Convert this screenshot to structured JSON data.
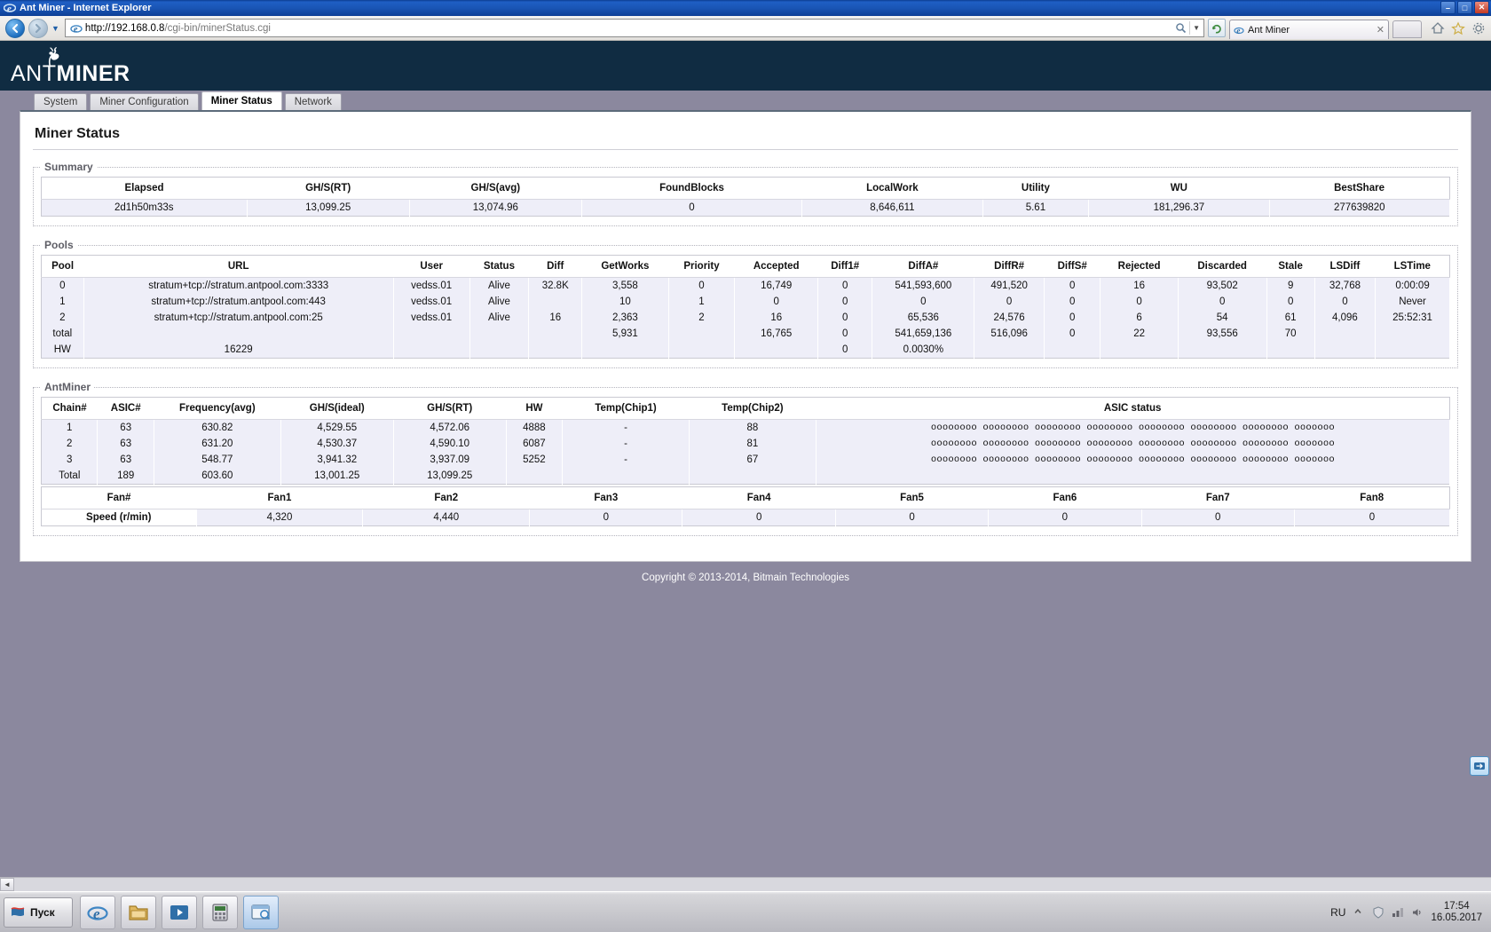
{
  "window": {
    "title": "Ant Miner - Internet Explorer",
    "minimize_label": "–",
    "maximize_label": "□",
    "close_label": "✕"
  },
  "browser": {
    "back_label": "◄",
    "forward_label": "►",
    "history_caret": "▼",
    "url_host": "http://192.168.0.8",
    "url_path": "/cgi-bin/minerStatus.cgi",
    "url_full": "http://192.168.0.8/cgi-bin/minerStatus.cgi",
    "tab_title": "Ant Miner",
    "tab_close": "✕",
    "refresh_label": "↯",
    "home_icon": "home-icon",
    "favorites_icon": "star-icon",
    "tools_icon": "gear-icon"
  },
  "site": {
    "logo_ant": "ANT",
    "logo_miner": "MINER",
    "nav_tabs": [
      {
        "label": "System",
        "active": false
      },
      {
        "label": "Miner Configuration",
        "active": false
      },
      {
        "label": "Miner Status",
        "active": true
      },
      {
        "label": "Network",
        "active": false
      }
    ],
    "page_title": "Miner Status",
    "copyright": "Copyright © 2013-2014, Bitmain Technologies"
  },
  "summary": {
    "legend": "Summary",
    "headers": [
      "Elapsed",
      "GH/S(RT)",
      "GH/S(avg)",
      "FoundBlocks",
      "LocalWork",
      "Utility",
      "WU",
      "BestShare"
    ],
    "values": [
      "2d1h50m33s",
      "13,099.25",
      "13,074.96",
      "0",
      "8,646,611",
      "5.61",
      "181,296.37",
      "277639820"
    ]
  },
  "pools": {
    "legend": "Pools",
    "headers": [
      "Pool",
      "URL",
      "User",
      "Status",
      "Diff",
      "GetWorks",
      "Priority",
      "Accepted",
      "Diff1#",
      "DiffA#",
      "DiffR#",
      "DiffS#",
      "Rejected",
      "Discarded",
      "Stale",
      "LSDiff",
      "LSTime"
    ],
    "rows": [
      [
        "0",
        "stratum+tcp://stratum.antpool.com:3333",
        "vedss.01",
        "Alive",
        "32.8K",
        "3,558",
        "0",
        "16,749",
        "0",
        "541,593,600",
        "491,520",
        "0",
        "16",
        "93,502",
        "9",
        "32,768",
        "0:00:09"
      ],
      [
        "1",
        "stratum+tcp://stratum.antpool.com:443",
        "vedss.01",
        "Alive",
        "",
        "10",
        "1",
        "0",
        "0",
        "0",
        "0",
        "0",
        "0",
        "0",
        "0",
        "0",
        "Never"
      ],
      [
        "2",
        "stratum+tcp://stratum.antpool.com:25",
        "vedss.01",
        "Alive",
        "16",
        "2,363",
        "2",
        "16",
        "0",
        "65,536",
        "24,576",
        "0",
        "6",
        "54",
        "61",
        "4,096",
        "25:52:31"
      ],
      [
        "total",
        "",
        "",
        "",
        "",
        "5,931",
        "",
        "16,765",
        "0",
        "541,659,136",
        "516,096",
        "0",
        "22",
        "93,556",
        "70",
        "",
        ""
      ],
      [
        "HW",
        "16229",
        "",
        "",
        "",
        "",
        "",
        "",
        "0",
        "0.0030%",
        "",
        "",
        "",
        "",
        "",
        "",
        ""
      ]
    ]
  },
  "antminer": {
    "legend": "AntMiner",
    "headers": [
      "Chain#",
      "ASIC#",
      "Frequency(avg)",
      "GH/S(ideal)",
      "GH/S(RT)",
      "HW",
      "Temp(Chip1)",
      "Temp(Chip2)",
      "ASIC status"
    ],
    "rows": [
      [
        "1",
        "63",
        "630.82",
        "4,529.55",
        "4,572.06",
        "4888",
        "-",
        "88",
        "oooooooo oooooooo oooooooo oooooooo oooooooo oooooooo oooooooo ooooooo"
      ],
      [
        "2",
        "63",
        "631.20",
        "4,530.37",
        "4,590.10",
        "6087",
        "-",
        "81",
        "oooooooo oooooooo oooooooo oooooooo oooooooo oooooooo oooooooo ooooooo"
      ],
      [
        "3",
        "63",
        "548.77",
        "3,941.32",
        "3,937.09",
        "5252",
        "-",
        "67",
        "oooooooo oooooooo oooooooo oooooooo oooooooo oooooooo oooooooo ooooooo"
      ],
      [
        "Total",
        "189",
        "603.60",
        "13,001.25",
        "13,099.25",
        "",
        "",
        "",
        ""
      ]
    ]
  },
  "fans": {
    "headers": [
      "Fan#",
      "Fan1",
      "Fan2",
      "Fan3",
      "Fan4",
      "Fan5",
      "Fan6",
      "Fan7",
      "Fan8"
    ],
    "row_label": "Speed (r/min)",
    "values": [
      "4,320",
      "4,440",
      "0",
      "0",
      "0",
      "0",
      "0",
      "0"
    ]
  },
  "taskbar": {
    "start_label": "Пуск",
    "items": [
      {
        "name": "internet-explorer",
        "glyph": "e",
        "active": true
      },
      {
        "name": "file-explorer",
        "glyph": "🗂",
        "active": false
      },
      {
        "name": "media-player",
        "glyph": "▶",
        "active": false
      },
      {
        "name": "calculator",
        "glyph": "▤",
        "active": false
      },
      {
        "name": "browser-window",
        "glyph": "◧",
        "active": false
      }
    ],
    "language": "RU",
    "time": "17:54",
    "date": "16.05.2017"
  },
  "colors": {
    "header_bg": "#102c42",
    "desktop": "#8b889e",
    "row_bg": "#eeeef8",
    "title_blue": "#1a55b5"
  }
}
